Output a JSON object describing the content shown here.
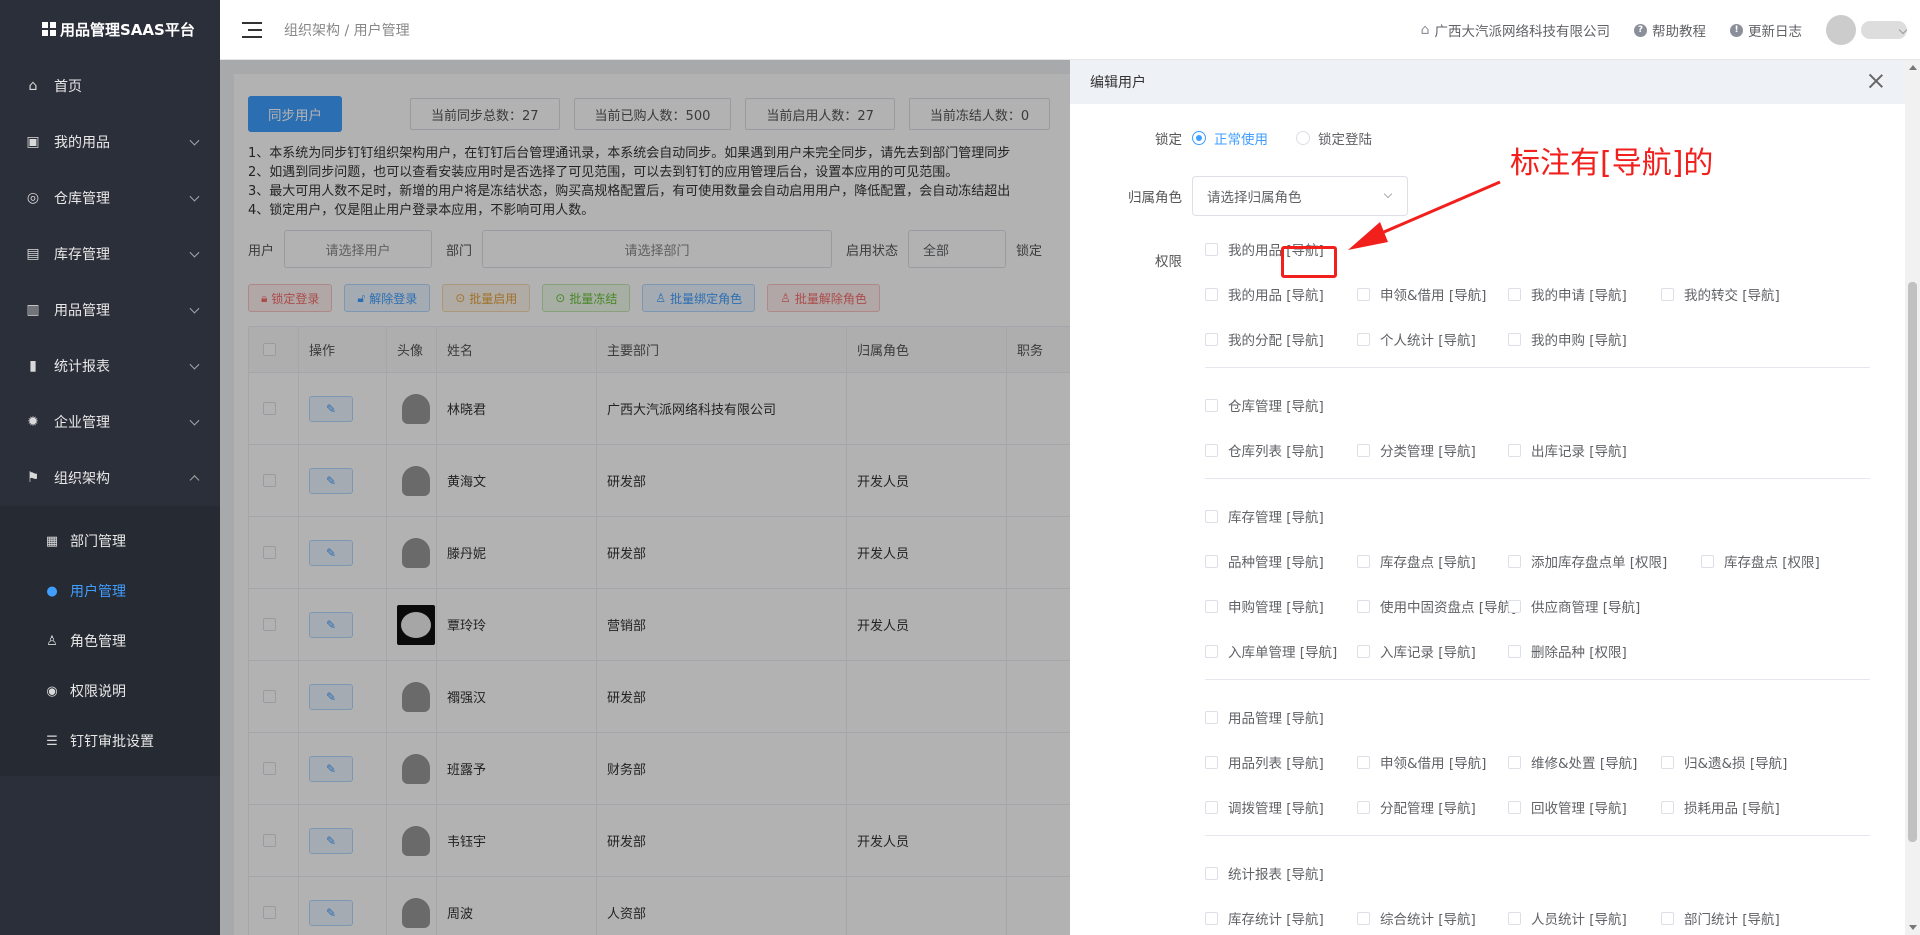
{
  "app": {
    "title": "用品管理SAAS平台"
  },
  "sidebar": {
    "items": [
      {
        "label": "首页",
        "icon": "home-icon"
      },
      {
        "label": "我的用品",
        "icon": "briefcase-icon"
      },
      {
        "label": "仓库管理",
        "icon": "database-icon"
      },
      {
        "label": "库存管理",
        "icon": "box-icon"
      },
      {
        "label": "用品管理",
        "icon": "inbox-icon"
      },
      {
        "label": "统计报表",
        "icon": "bar-chart-icon"
      },
      {
        "label": "企业管理",
        "icon": "gear-icon"
      },
      {
        "label": "组织架构",
        "icon": "flag-icon"
      }
    ],
    "sub_items": [
      {
        "label": "部门管理",
        "icon": "grid-icon"
      },
      {
        "label": "用户管理",
        "icon": "user-icon"
      },
      {
        "label": "角色管理",
        "icon": "user-outline-icon"
      },
      {
        "label": "权限说明",
        "icon": "location-icon"
      },
      {
        "label": "钉钉审批设置",
        "icon": "sliders-icon"
      }
    ]
  },
  "header": {
    "breadcrumb": "组织架构 / 用户管理",
    "company": "广西大汽派网络科技有限公司",
    "help": "帮助教程",
    "changelog": "更新日志"
  },
  "main": {
    "sync_button": "同步用户",
    "stats": [
      "当前同步总数：27",
      "当前已购人数：500",
      "当前启用人数：27",
      "当前冻结人数：0"
    ],
    "notes": [
      "1、本系统为同步钉钉组织架构用户，在钉钉后台管理通讯录，本系统会自动同步。如果遇到用户未完全同步，请先去到部门管理同步",
      "2、如遇到同步问题，也可以查看安装应用时是否选择了可见范围，可以去到钉钉的应用管理后台，设置本应用的可见范围。",
      "3、最大可用人数不足时，新增的用户将是冻结状态，购买高规格配置后，有可使用数量会自动启用用户，降低配置，会自动冻结超出",
      "4、锁定用户，仅是阻止用户登录本应用，不影响可用人数。"
    ],
    "filters": {
      "user_label": "用户",
      "user_placeholder": "请选择用户",
      "dept_label": "部门",
      "dept_placeholder": "请选择部门",
      "status_label": "启用状态",
      "status_value": "全部",
      "lock_label": "锁定"
    },
    "actions": [
      "锁定登录",
      "解除登录",
      "批量启用",
      "批量冻结",
      "批量绑定角色",
      "批量解除角色"
    ],
    "table": {
      "headers": [
        "操作",
        "头像",
        "姓名",
        "主要部门",
        "归属角色",
        "职务"
      ],
      "rows": [
        {
          "name": "林晓君",
          "dept": "广西大汽派网络科技有限公司",
          "role": ""
        },
        {
          "name": "黄海文",
          "dept": "研发部",
          "role": "开发人员"
        },
        {
          "name": "滕丹妮",
          "dept": "研发部",
          "role": "开发人员"
        },
        {
          "name": "覃玲玲",
          "dept": "营销部",
          "role": "开发人员"
        },
        {
          "name": "禤强汉",
          "dept": "研发部",
          "role": ""
        },
        {
          "name": "班露予",
          "dept": "财务部",
          "role": ""
        },
        {
          "name": "韦钰宇",
          "dept": "研发部",
          "role": "开发人员"
        },
        {
          "name": "周波",
          "dept": "人资部",
          "role": ""
        }
      ]
    }
  },
  "drawer": {
    "title": "编辑用户",
    "lock_label": "锁定",
    "lock_options": [
      "正常使用",
      "锁定登陆"
    ],
    "role_label": "归属角色",
    "role_placeholder": "请选择归属角色",
    "perm_label": "权限",
    "perm_groups": [
      {
        "top": "我的用品 [导航]",
        "rows": [
          [
            "我的用品 [导航]",
            "申领&借用 [导航]",
            "我的申请 [导航]",
            "我的转交 [导航]"
          ],
          [
            "我的分配 [导航]",
            "个人统计 [导航]",
            "我的申购 [导航]"
          ]
        ]
      },
      {
        "top": "仓库管理 [导航]",
        "rows": [
          [
            "仓库列表 [导航]",
            "分类管理 [导航]",
            "出库记录 [导航]"
          ]
        ]
      },
      {
        "top": "库存管理 [导航]",
        "rows": [
          [
            "品种管理 [导航]",
            "库存盘点 [导航]",
            "添加库存盘点单 [权限]",
            "库存盘点 [权限]"
          ],
          [
            "申购管理 [导航]",
            "使用中固资盘点 [导航]",
            "供应商管理 [导航]"
          ],
          [
            "入库单管理 [导航]",
            "入库记录 [导航]",
            "删除品种 [权限]"
          ]
        ]
      },
      {
        "top": "用品管理 [导航]",
        "rows": [
          [
            "用品列表 [导航]",
            "申领&借用 [导航]",
            "维修&处置 [导航]",
            "归&遗&损 [导航]"
          ],
          [
            "调拨管理 [导航]",
            "分配管理 [导航]",
            "回收管理 [导航]",
            "损耗用品 [导航]"
          ]
        ]
      },
      {
        "top": "统计报表 [导航]",
        "rows": [
          [
            "库存统计 [导航]",
            "综合统计 [导航]",
            "人员统计 [导航]",
            "部门统计 [导航]"
          ]
        ]
      }
    ]
  },
  "annotation": {
    "text": "标注有[导航]的"
  },
  "colors": {
    "primary": "#409eff",
    "annotation": "#f2201d",
    "sidebar": "#2b2f3a"
  }
}
